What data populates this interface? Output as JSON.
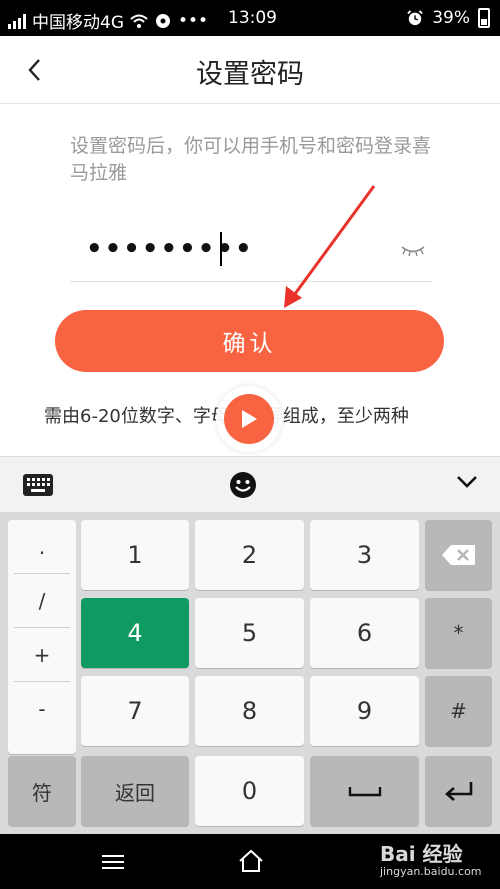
{
  "status_bar": {
    "carrier": "中国移动4G",
    "time": "13:09",
    "battery": "39%"
  },
  "header": {
    "title": "设置密码"
  },
  "form": {
    "hint": "设置密码后，你可以用手机号和密码登录喜马拉雅",
    "password_masked": "•••••••••",
    "confirm_label": "确认",
    "rule": "需由6-20位数字、字母、符号组成，至少两种"
  },
  "keyboard": {
    "symbols": [
      ".",
      "/",
      "+",
      "-"
    ],
    "digits": [
      "1",
      "2",
      "3",
      "4",
      "5",
      "6",
      "7",
      "8",
      "9"
    ],
    "star": "*",
    "hash": "#",
    "sym_label": "符",
    "back_label": "返回",
    "zero": "0",
    "highlighted_key": "4"
  },
  "watermark": {
    "brand": "Bai 经验",
    "url": "jingyan.baidu.com"
  },
  "colors": {
    "accent": "#f86442",
    "key_highlight": "#0f9a62"
  }
}
